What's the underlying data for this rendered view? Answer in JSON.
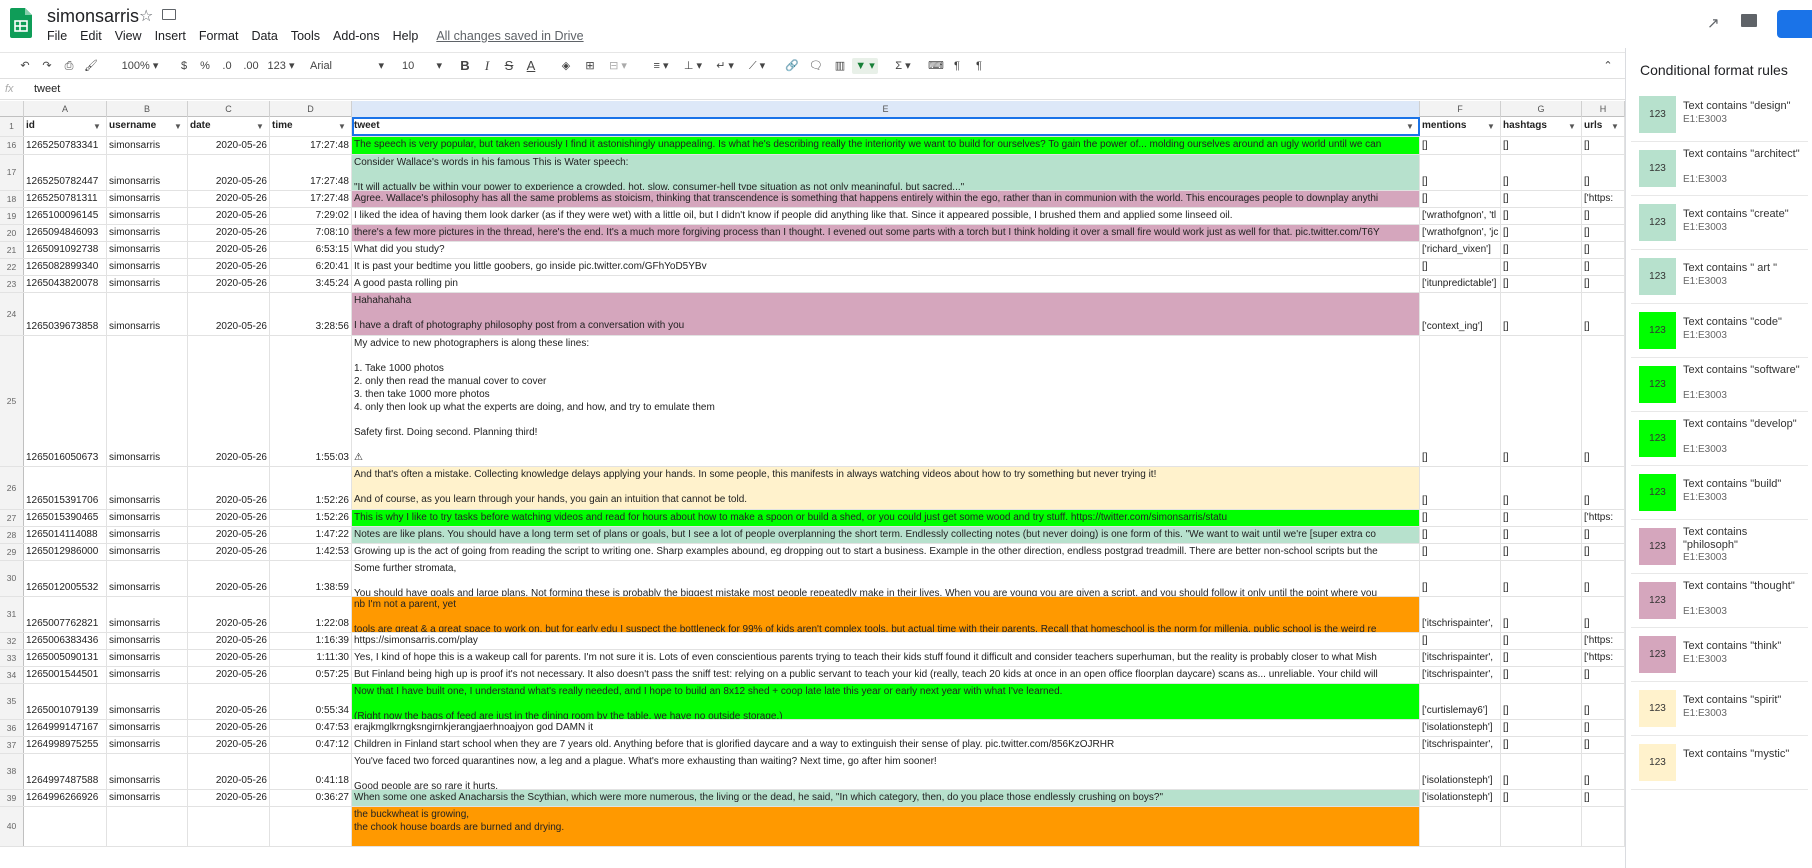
{
  "app": {
    "title": "simonsarris",
    "saved": "All changes saved in Drive"
  },
  "menu": [
    "File",
    "Edit",
    "View",
    "Insert",
    "Format",
    "Data",
    "Tools",
    "Add-ons",
    "Help"
  ],
  "toolbar": {
    "zoom": "100%",
    "currency": "$",
    "percent": "%",
    "dec_less": ".0",
    "dec_more": ".00",
    "format": "123",
    "font": "Arial",
    "size": "10"
  },
  "formula": {
    "fx": "fx",
    "value": "tweet"
  },
  "columns": [
    {
      "letter": "A"
    },
    {
      "letter": "B"
    },
    {
      "letter": "C"
    },
    {
      "letter": "D"
    },
    {
      "letter": "E"
    },
    {
      "letter": "F"
    },
    {
      "letter": "G"
    },
    {
      "letter": "H"
    }
  ],
  "header": {
    "num": "1",
    "cells": [
      "id",
      "username",
      "date",
      "time",
      "tweet",
      "mentions",
      "hashtags",
      "urls"
    ]
  },
  "rows": [
    {
      "num": "16",
      "h": 18,
      "bg": "#00ff00",
      "id": "1265250783341",
      "user": "simonsarris",
      "date": "2020-05-26",
      "time": "17:27:48",
      "tweet": "The speech is very popular, but taken seriously I find it astonishingly unappealing. Is what he's describing really the interiority we want to build for ourselves? To gain the power of... molding ourselves around an ugly world until we can",
      "mentions": "[]",
      "hashtags": "[]",
      "urls": "[]"
    },
    {
      "num": "17",
      "h": 36,
      "bg": "#b7e1cd",
      "id": "1265250782447",
      "user": "simonsarris",
      "date": "2020-05-26",
      "time": "17:27:48",
      "tweet": "Consider Wallace's words in his famous This is Water speech:\n\n\"It will actually be within your power to experience a crowded, hot, slow, consumer-hell type situation as not only meaningful, but sacred...\"",
      "mentions": "[]",
      "hashtags": "[]",
      "urls": "[]"
    },
    {
      "num": "18",
      "h": 17,
      "bg": "#d5a6bd",
      "id": "1265250781311",
      "user": "simonsarris",
      "date": "2020-05-26",
      "time": "17:27:48",
      "tweet": "Agree. Wallace's philosophy has all the same problems as stoicism, thinking that transcendence is something that happens entirely within the ego, rather than in communion with the world. This encourages people to downplay anythi",
      "mentions": "[]",
      "hashtags": "[]",
      "urls": "['https:"
    },
    {
      "num": "19",
      "h": 17,
      "bg": "#ffffff",
      "id": "1265100096145",
      "user": "simonsarris",
      "date": "2020-05-26",
      "time": "7:29:02",
      "tweet": "I liked the idea of having them look darker (as if they were wet) with a little oil, but I didn't know if people did anything like that. Since it appeared possible, I brushed them and applied some linseed oil.",
      "mentions": "['wrathofgnon', 'tl",
      "hashtags": "[]",
      "urls": "[]"
    },
    {
      "num": "20",
      "h": 17,
      "bg": "#d5a6bd",
      "id": "1265094846093",
      "user": "simonsarris",
      "date": "2020-05-26",
      "time": "7:08:10",
      "tweet": "there's a few more pictures in the thread, here's the end. It's a much more forgiving process than I thought. I evened out some parts with a torch but I think holding it over a small fire would work just as well for that. pic.twitter.com/T6Y",
      "mentions": "['wrathofgnon', 'jc",
      "hashtags": "[]",
      "urls": "[]"
    },
    {
      "num": "21",
      "h": 17,
      "bg": "#ffffff",
      "id": "1265091092738",
      "user": "simonsarris",
      "date": "2020-05-26",
      "time": "6:53:15",
      "tweet": "What did you study?",
      "mentions": "['richard_vixen']",
      "hashtags": "[]",
      "urls": "[]"
    },
    {
      "num": "22",
      "h": 17,
      "bg": "#ffffff",
      "id": "1265082899340",
      "user": "simonsarris",
      "date": "2020-05-26",
      "time": "6:20:41",
      "tweet": "It is past your bedtime you little goobers, go inside pic.twitter.com/GFhYoD5YBv",
      "mentions": "[]",
      "hashtags": "[]",
      "urls": "[]"
    },
    {
      "num": "23",
      "h": 17,
      "bg": "#ffffff",
      "id": "1265043820078",
      "user": "simonsarris",
      "date": "2020-05-26",
      "time": "3:45:24",
      "tweet": "A good pasta rolling pin",
      "mentions": "['itunpredictable']",
      "hashtags": "[]",
      "urls": "[]"
    },
    {
      "num": "24",
      "h": 43,
      "bg": "#d5a6bd",
      "id": "1265039673858",
      "user": "simonsarris",
      "date": "2020-05-26",
      "time": "3:28:56",
      "tweet": "Hahahahaha\n\nI have a draft of photography philosophy post from a conversation with you",
      "mentions": "['context_ing']",
      "hashtags": "[]",
      "urls": "[]"
    },
    {
      "num": "25",
      "h": 131,
      "bg": "#ffffff",
      "id": "1265016050673",
      "user": "simonsarris",
      "date": "2020-05-26",
      "time": "1:55:03",
      "tweet": "My advice to new photographers is along these lines:\n\n1. Take 1000 photos\n2. only then read the manual cover to cover\n3. then take 1000 more photos\n4. only then look up what the experts are doing, and how, and try to emulate them\n\nSafety first. Doing second. Planning third!\n\n⚠",
      "mentions": "[]",
      "hashtags": "[]",
      "urls": "[]"
    },
    {
      "num": "26",
      "h": 43,
      "bg": "#fff2cc",
      "id": "1265015391706",
      "user": "simonsarris",
      "date": "2020-05-26",
      "time": "1:52:26",
      "tweet": "And that's often a mistake. Collecting knowledge delays applying your hands. In some people, this manifests in always watching videos about how to try something but never trying it!\n\nAnd of course, as you learn through your hands, you gain an intuition that cannot be told.",
      "mentions": "[]",
      "hashtags": "[]",
      "urls": "[]"
    },
    {
      "num": "27",
      "h": 17,
      "bg": "#00ff00",
      "id": "1265015390465",
      "user": "simonsarris",
      "date": "2020-05-26",
      "time": "1:52:26",
      "tweet": "This is why I like to try tasks before watching videos and read for hours about how to make a spoon or build a shed, or you could just get some wood and try stuff. https://twitter.com/simonsarris/statu",
      "mentions": "[]",
      "hashtags": "[]",
      "urls": "['https:"
    },
    {
      "num": "28",
      "h": 17,
      "bg": "#b7e1cd",
      "id": "1265014114088",
      "user": "simonsarris",
      "date": "2020-05-26",
      "time": "1:47:22",
      "tweet": "Notes are like plans. You should have a long term set of plans or goals, but I see a lot of people overplanning the short term. Endlessly collecting notes (but never doing) is one form of this. \"We want to wait until we're [super extra co",
      "mentions": "[]",
      "hashtags": "[]",
      "urls": "[]"
    },
    {
      "num": "29",
      "h": 17,
      "bg": "#ffffff",
      "id": "1265012986000",
      "user": "simonsarris",
      "date": "2020-05-26",
      "time": "1:42:53",
      "tweet": "Growing up is the act of going from reading the script to writing one. Sharp examples abound, eg dropping out to start a business. Example in the other direction, endless postgrad treadmill. There are better non-school scripts but the",
      "mentions": "[]",
      "hashtags": "[]",
      "urls": "[]"
    },
    {
      "num": "30",
      "h": 36,
      "bg": "#ffffff",
      "id": "1265012005532",
      "user": "simonsarris",
      "date": "2020-05-26",
      "time": "1:38:59",
      "tweet": "Some further stromata,\n\nYou should have goals and large plans. Not forming these is probably the biggest mistake most people repeatedly make in their lives. When you are young you are given a script, and you should follow it only until the point where you",
      "mentions": "[]",
      "hashtags": "[]",
      "urls": "[]"
    },
    {
      "num": "31",
      "h": 36,
      "bg": "#ff9900",
      "id": "1265007762821",
      "user": "simonsarris",
      "date": "2020-05-26",
      "time": "1:22:08",
      "tweet": "nb I'm not a parent, yet\n\ntools are great & a great space to work on, but for early edu I suspect the bottleneck for 99% of kids aren't complex tools, but actual time with their parents. Recall that homeschool is the norm for millenia, public school is the weird re",
      "mentions": "['itschrispainter',",
      "hashtags": "[]",
      "urls": "[]"
    },
    {
      "num": "32",
      "h": 17,
      "bg": "#ffffff",
      "id": "1265006383436",
      "user": "simonsarris",
      "date": "2020-05-26",
      "time": "1:16:39",
      "tweet": "https://simonsarris.com/play",
      "mentions": "[]",
      "hashtags": "[]",
      "urls": "['https:"
    },
    {
      "num": "33",
      "h": 17,
      "bg": "#ffffff",
      "id": "1265005090131",
      "user": "simonsarris",
      "date": "2020-05-26",
      "time": "1:11:30",
      "tweet": "Yes, I kind of hope this is a wakeup call for parents. I'm not sure it is. Lots of even conscientious parents trying to teach their kids stuff found it difficult and consider teachers superhuman, but the reality is probably closer to what Mish",
      "mentions": "['itschrispainter',",
      "hashtags": "[]",
      "urls": "['https:"
    },
    {
      "num": "34",
      "h": 17,
      "bg": "#ffffff",
      "id": "1265001544501",
      "user": "simonsarris",
      "date": "2020-05-26",
      "time": "0:57:25",
      "tweet": "But Finland being high up is proof it's not necessary. It also doesn't pass the sniff test: relying on a public servant to teach your kid (really, teach 20 kids at once in an open office floorplan daycare) scans as... unreliable. Your child will",
      "mentions": "['itschrispainter',",
      "hashtags": "[]",
      "urls": "[]"
    },
    {
      "num": "35",
      "h": 36,
      "bg": "#00ff00",
      "id": "1265001079139",
      "user": "simonsarris",
      "date": "2020-05-26",
      "time": "0:55:34",
      "tweet": "Now that I have built one, I understand what's really needed, and I hope to build an 8x12 shed + coop late late this year or early next year with what I've learned.\n\n(Right now the bags of feed are just in the dining room by the table, we have no outside storage.)",
      "mentions": "['curtislemay6']",
      "hashtags": "[]",
      "urls": "[]"
    },
    {
      "num": "36",
      "h": 17,
      "bg": "#ffffff",
      "id": "1264999147167",
      "user": "simonsarris",
      "date": "2020-05-26",
      "time": "0:47:53",
      "tweet": "erajkmglkrngksngirnkjerangjaerhnoajyon god DAMN it",
      "mentions": "['isolationsteph']",
      "hashtags": "[]",
      "urls": "[]"
    },
    {
      "num": "37",
      "h": 17,
      "bg": "#ffffff",
      "id": "1264998975255",
      "user": "simonsarris",
      "date": "2020-05-26",
      "time": "0:47:12",
      "tweet": "Children in Finland start school when they are 7 years old. Anything before that is glorified daycare and a way to extinguish their sense of play. pic.twitter.com/856KzOJRHR",
      "mentions": "['itschrispainter',",
      "hashtags": "[]",
      "urls": "[]"
    },
    {
      "num": "38",
      "h": 36,
      "bg": "#ffffff",
      "id": "1264997487588",
      "user": "simonsarris",
      "date": "2020-05-26",
      "time": "0:41:18",
      "tweet": "You've faced two forced quarantines now, a leg and a plague. What's more exhausting than waiting? Next time, go after him sooner!\n\nGood people are so rare it hurts.",
      "mentions": "['isolationsteph']",
      "hashtags": "[]",
      "urls": "[]"
    },
    {
      "num": "39",
      "h": 17,
      "bg": "#b7e1cd",
      "id": "1264996266926",
      "user": "simonsarris",
      "date": "2020-05-26",
      "time": "0:36:27",
      "tweet": "When some one asked Anacharsis the Scythian, which were more numerous, the living or the dead, he said, \"In which category, then, do you place those endlessly crushing on boys?\"",
      "mentions": "['isolationsteph']",
      "hashtags": "[]",
      "urls": "[]"
    },
    {
      "num": "40",
      "h": 40,
      "bg": "#ff9900",
      "id": "",
      "user": "",
      "date": "",
      "time": "",
      "tweet": "the buckwheat is growing,\nthe chook house boards are burned and drying.",
      "mentions": "",
      "hashtags": "",
      "urls": ""
    }
  ],
  "sidebar": {
    "title": "Conditional format rules",
    "sample": "123",
    "rules": [
      {
        "text": "Text contains \"design\"",
        "range": "E1:E3003",
        "color": "#b7e1cd"
      },
      {
        "text": "Text contains \"architect\"",
        "range": "E1:E3003",
        "color": "#b7e1cd"
      },
      {
        "text": "Text contains \"create\"",
        "range": "E1:E3003",
        "color": "#b7e1cd"
      },
      {
        "text": "Text contains \" art \"",
        "range": "E1:E3003",
        "color": "#b7e1cd"
      },
      {
        "text": "Text contains \"code\"",
        "range": "E1:E3003",
        "color": "#00ff00"
      },
      {
        "text": "Text contains \"software\"",
        "range": "E1:E3003",
        "color": "#00ff00"
      },
      {
        "text": "Text contains \"develop\"",
        "range": "E1:E3003",
        "color": "#00ff00"
      },
      {
        "text": "Text contains \"build\"",
        "range": "E1:E3003",
        "color": "#00ff00"
      },
      {
        "text": "Text contains \"philosoph\"",
        "range": "E1:E3003",
        "color": "#d5a6bd"
      },
      {
        "text": "Text contains \"thought\"",
        "range": "E1:E3003",
        "color": "#d5a6bd"
      },
      {
        "text": "Text contains \"think\"",
        "range": "E1:E3003",
        "color": "#d5a6bd"
      },
      {
        "text": "Text contains \"spirit\"",
        "range": "E1:E3003",
        "color": "#fff2cc"
      },
      {
        "text": "Text contains \"mystic\"",
        "range": "",
        "color": "#fff2cc"
      }
    ]
  }
}
